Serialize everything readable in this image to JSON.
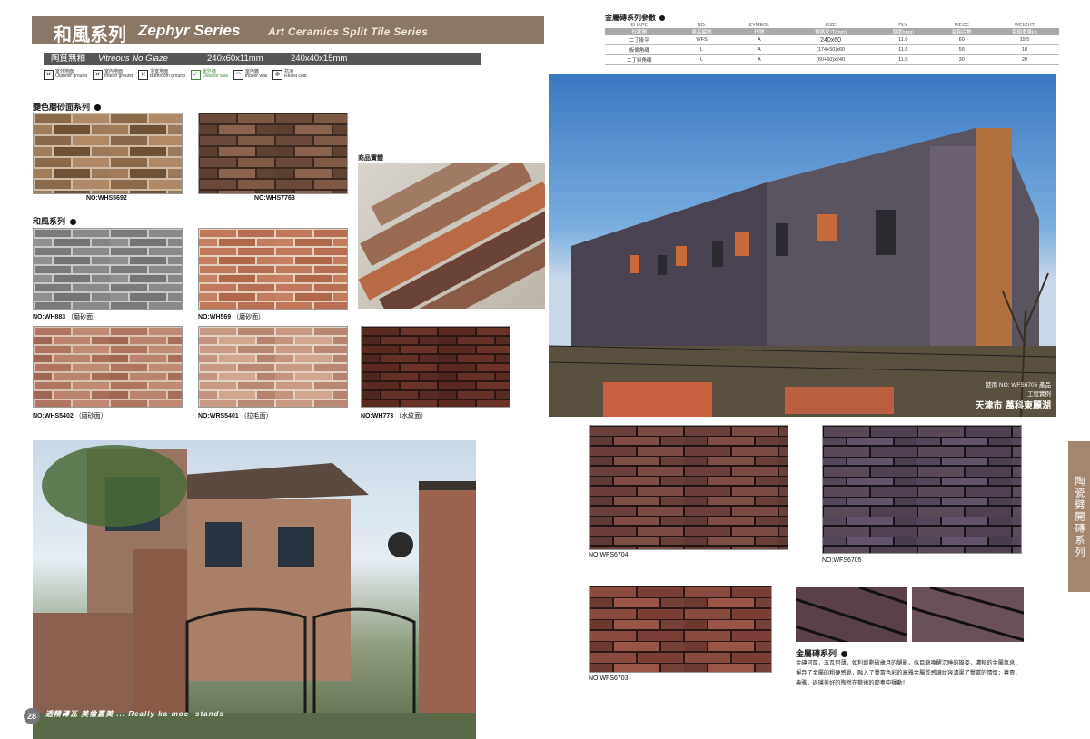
{
  "header": {
    "title_cn": "和風系列",
    "title_en": "Zephyr Series",
    "subtitle": "Art Ceramics Split Tile Series"
  },
  "specbar": {
    "label_cn": "陶質無釉",
    "label_en": "Vitreous No Glaze",
    "size1": "240x60x11mm",
    "size2": "240x40x15mm"
  },
  "usage_icons": [
    {
      "cn": "室外地面",
      "en": "Outdoor ground",
      "mark": "✕"
    },
    {
      "cn": "室內地面",
      "en": "Indoor ground",
      "mark": "✕"
    },
    {
      "cn": "浴室地面",
      "en": "Bathroom ground",
      "mark": "✕"
    },
    {
      "cn": "室外牆",
      "en": "Outdoor wall",
      "mark": "✓"
    },
    {
      "cn": "室內牆",
      "en": "Indoor wall",
      "mark": "◠"
    },
    {
      "cn": "抗凍",
      "en": "Resist cold",
      "mark": "❄"
    }
  ],
  "sections": {
    "matte": "變色磨砂面系列",
    "zephyr": "和風系列",
    "product_photo": "商品實體",
    "metal": "金屬磚系列"
  },
  "tiles": {
    "whs5692": "NO:WHS5692",
    "whs7763": "NO:WHS7763",
    "wh883": "NO:WH883",
    "wh883_note": "（磨砂面）",
    "wh569": "NO:WH569",
    "wh569_note": "（磨砂面）",
    "whs5402": "NO:WHS5402",
    "whs5402_note": "（磨砂面）",
    "wrs5401": "NO:WRS5401",
    "wrs5401_note": "（拉毛面）",
    "wh773": "NO:WH773",
    "wh773_note": "（水紋面）",
    "wfs6704": "NO:WFS6704",
    "wfs6705": "NO:WFS6705",
    "wfs6703": "NO:WFS6703"
  },
  "spec_table": {
    "title": "金屬磚系列參數",
    "head1": [
      "SHAPE",
      "NO.",
      "SYMBOL",
      "SIZE",
      "PLY",
      "PIECE",
      "WEIGHT"
    ],
    "head2": [
      "形狀圖",
      "產品編號",
      "代號",
      "規格尺寸(mm)",
      "厚度(mm)",
      "每箱片數",
      "每箱重量kg"
    ],
    "rows": [
      [
        "二丁掛平",
        "WFS",
        "A",
        "240x60",
        "11.0",
        "60",
        "19.5"
      ],
      [
        "板條角磚",
        "L",
        "A",
        "(174+50)x60",
        "11.0",
        "56",
        "18"
      ],
      [
        "二丁掛角磚",
        "L",
        "A",
        "(60+60)x240",
        "11.0",
        "30",
        "20"
      ]
    ]
  },
  "photo_caption": {
    "line1": "使用 NO: WFS6705 產品",
    "line2": "工程實例",
    "line3": "天津市 萬科東麗湖"
  },
  "side_tab": "陶瓷劈開磚系列",
  "metal_desc": "金磚何厚，玉瓦何薄，如利劍劃破歲月的腿影，似巨龍喚醒沉睡的雄姿，濃郁的金屬氣息，摒弃了金屬的粗硬感覺，融入了豐富色彩的高雅金屬質感讓紋容溝渠了豐富的情懷；尊貴，典雅，返璞美好的陶然在藝術的節奏中揮動！",
  "page_number": "28",
  "slogan": "透精磚瓦 美倫嘉美  ... Really ka·moe ·stands",
  "colors": {
    "header_bg": "#8a7766",
    "side_tab_bg": "#a38670",
    "spec_bar_bg": "#555555"
  }
}
